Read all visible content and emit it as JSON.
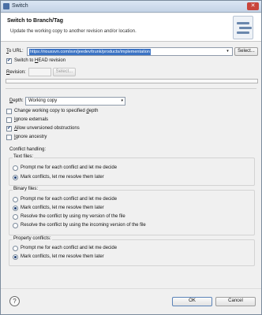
{
  "window": {
    "title": "Switch"
  },
  "header": {
    "title": "Switch to Branch/Tag",
    "description": "Update the working copy to another revision and/or location."
  },
  "url": {
    "label_pre": "",
    "label_underline": "T",
    "label_post": "o URL:",
    "value": "https://riouxsvn.com/svn/jeedev/trunk/products/implementation",
    "select_button": "Select..."
  },
  "switch_head": {
    "label_pre": "Switch to ",
    "label_underline": "H",
    "label_post": "EAD revision",
    "checked": true
  },
  "revision": {
    "label_pre": "",
    "label_underline": "R",
    "label_post": "evision:",
    "value": "",
    "select_button": "Select..."
  },
  "depth": {
    "label_pre": "",
    "label_underline": "D",
    "label_post": "epth:",
    "selected": "Working copy"
  },
  "options": [
    {
      "pre": "Change working copy to specified ",
      "u": "d",
      "post": "epth",
      "checked": false
    },
    {
      "pre": "",
      "u": "I",
      "post": "gnore externals",
      "checked": false
    },
    {
      "pre": "",
      "u": "A",
      "post": "llow unversioned obstructions",
      "checked": true
    },
    {
      "pre": "",
      "u": "I",
      "post": "gnore ancestry",
      "checked": false
    }
  ],
  "conflict": {
    "heading": "Conflict handling:",
    "text_files": {
      "title": "Text files:",
      "options": [
        {
          "label": "Prompt me for each conflict and let me decide",
          "selected": false
        },
        {
          "label": "Mark conflicts, let me resolve them later",
          "selected": true
        }
      ]
    },
    "binary_files": {
      "title": "Binary files:",
      "options": [
        {
          "label": "Prompt me for each conflict and let me decide",
          "selected": false
        },
        {
          "label": "Mark conflicts, let me resolve them later",
          "selected": true
        },
        {
          "label": "Resolve the conflict by using my version of the file",
          "selected": false
        },
        {
          "label": "Resolve the conflict by using the incoming version of the file",
          "selected": false
        }
      ]
    },
    "property_conflicts": {
      "title": "Property conflicts:",
      "options": [
        {
          "label": "Prompt me for each conflict and let me decide",
          "selected": false
        },
        {
          "label": "Mark conflicts, let me resolve them later",
          "selected": true
        }
      ]
    }
  },
  "footer": {
    "help_icon": "?",
    "ok_label": "OK",
    "cancel_label": "Cancel"
  },
  "glyphs": {
    "check": "✔",
    "arrow": "▾",
    "close": "✕"
  }
}
